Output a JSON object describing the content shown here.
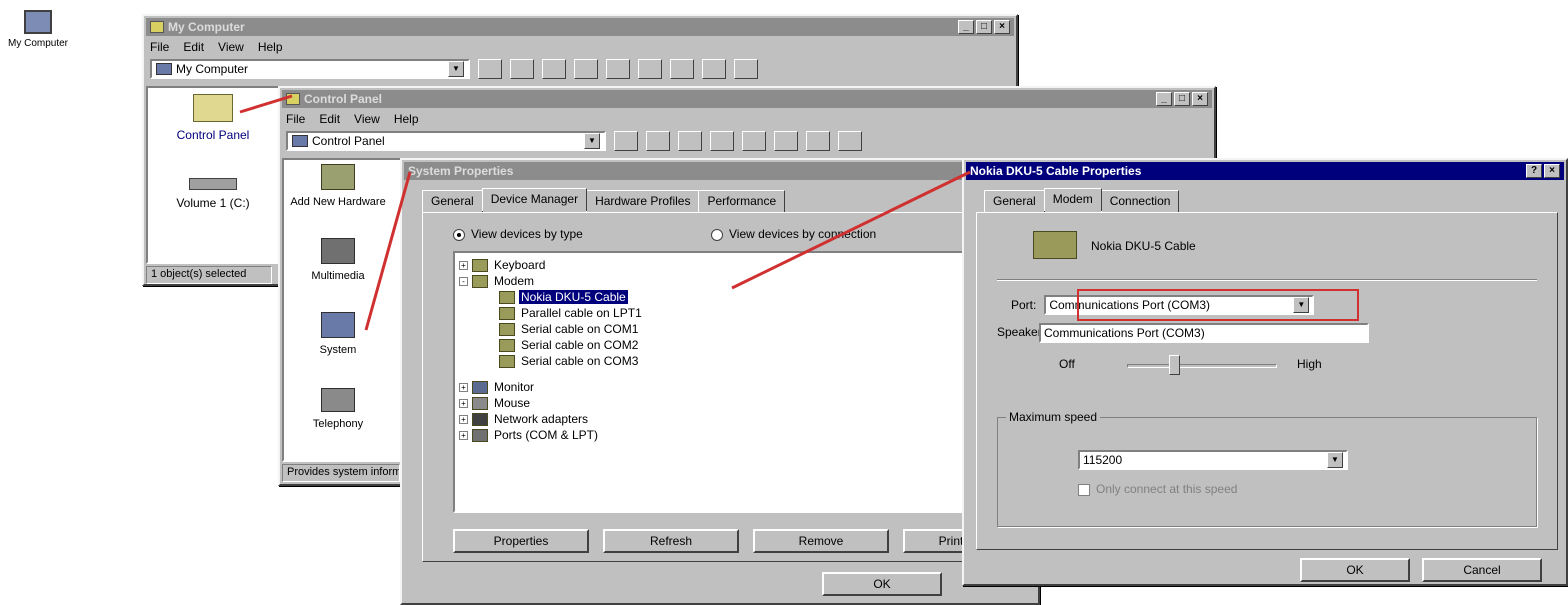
{
  "desktop": {
    "icon_label": "My Computer"
  },
  "my_computer": {
    "title": "My Computer",
    "menu": [
      "File",
      "Edit",
      "View",
      "Help"
    ],
    "address": "My Computer",
    "items": [
      "Control Panel",
      "Volume 1 (C:)"
    ],
    "status": "1 object(s) selected"
  },
  "control_panel": {
    "title": "Control Panel",
    "menu": [
      "File",
      "Edit",
      "View",
      "Help"
    ],
    "address": "Control Panel",
    "items": [
      "Add New Hardware",
      "Multimedia",
      "System",
      "Telephony"
    ],
    "status": "Provides system information"
  },
  "system_properties": {
    "title": "System Properties",
    "tabs": [
      "General",
      "Device Manager",
      "Hardware Profiles",
      "Performance"
    ],
    "active_tab": "Device Manager",
    "view_by_type": "View devices by type",
    "view_by_connection": "View devices by connection",
    "tree": [
      {
        "label": "Keyboard",
        "level": 0,
        "expander": "+"
      },
      {
        "label": "Modem",
        "level": 0,
        "expander": "-"
      },
      {
        "label": "Nokia DKU-5 Cable",
        "level": 1,
        "selected": true
      },
      {
        "label": "Parallel cable on LPT1",
        "level": 1
      },
      {
        "label": "Serial cable on COM1",
        "level": 1
      },
      {
        "label": "Serial cable on COM2",
        "level": 1
      },
      {
        "label": "Serial cable on COM3",
        "level": 1
      },
      {
        "label": "Monitor",
        "level": 0,
        "expander": "+"
      },
      {
        "label": "Mouse",
        "level": 0,
        "expander": "+"
      },
      {
        "label": "Network adapters",
        "level": 0,
        "expander": "+"
      },
      {
        "label": "Ports (COM & LPT)",
        "level": 0,
        "expander": "+"
      }
    ],
    "buttons": [
      "Properties",
      "Refresh",
      "Remove",
      "Print..."
    ],
    "ok": "OK"
  },
  "modem_properties": {
    "title": "Nokia DKU-5 Cable Properties",
    "tabs": [
      "General",
      "Modem",
      "Connection"
    ],
    "active_tab": "Modem",
    "device_name": "Nokia DKU-5 Cable",
    "port_label": "Port:",
    "port_value": "Communications Port (COM3)",
    "port_option_below": "Communications Port (COM3)",
    "speaker_label": "Speaker volume",
    "slider_low": "Off",
    "slider_high": "High",
    "volume_level": 0.3,
    "max_speed_label": "Maximum speed",
    "max_speed_value": "115200",
    "only_connect_label": "Only connect at this speed",
    "ok": "OK",
    "cancel": "Cancel"
  },
  "colors": {
    "active_title": "#00007c",
    "inactive_title": "#8c8c8c",
    "face": "#c0c0c0",
    "highlight_line": "#d03030"
  }
}
